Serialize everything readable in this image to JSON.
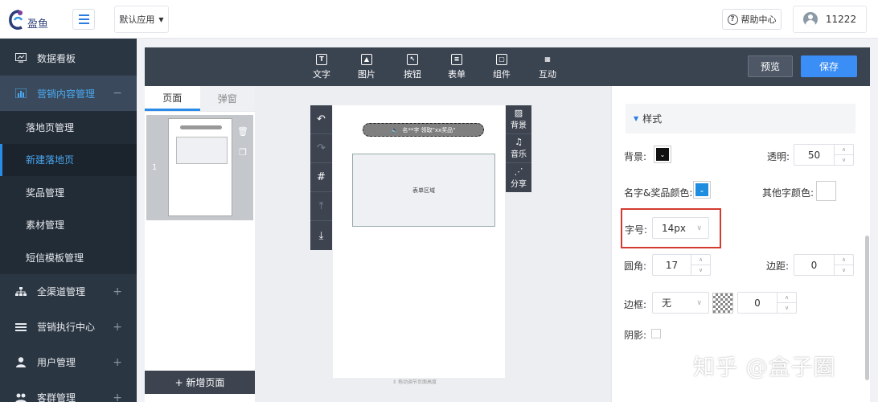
{
  "header": {
    "logo_text": "盈鱼",
    "app_select": "默认应用",
    "help": "帮助中心",
    "user": "11222"
  },
  "sidebar": {
    "items": [
      {
        "label": "数据看板",
        "icon": "dashboard-icon"
      },
      {
        "label": "营销内容管理",
        "icon": "chart-bar-icon",
        "sign": "−"
      },
      {
        "label": "落地页管理"
      },
      {
        "label": "新建落地页"
      },
      {
        "label": "奖品管理"
      },
      {
        "label": "素材管理"
      },
      {
        "label": "短信模板管理"
      },
      {
        "label": "全渠道管理",
        "icon": "sitemap-icon",
        "sign": "+"
      },
      {
        "label": "营销执行中心",
        "icon": "list-icon",
        "sign": "+"
      },
      {
        "label": "用户管理",
        "icon": "user-icon",
        "sign": "+"
      },
      {
        "label": "客群管理",
        "icon": "group-icon",
        "sign": "+"
      }
    ]
  },
  "toolbar": {
    "tools": [
      "文字",
      "图片",
      "按钮",
      "表单",
      "组件",
      "互动"
    ],
    "preview": "预览",
    "save": "保存"
  },
  "pages": {
    "tab_page": "页面",
    "tab_popup": "弹窗",
    "page_number": "1",
    "add_page": "+ 新增页面"
  },
  "canvas": {
    "notice": "名**字 领取\"xx奖品\"",
    "form_area": "表单区域",
    "bottom_hint": "拖动调节页面高度",
    "right_tools": [
      "背景",
      "音乐",
      "分享"
    ]
  },
  "props": {
    "section": "样式",
    "background_label": "背景:",
    "opacity_label": "透明:",
    "opacity_value": "50",
    "name_color_label": "名字&奖品颜色:",
    "other_color_label": "其他字颜色:",
    "font_size_label": "字号:",
    "font_size_value": "14px",
    "radius_label": "圆角:",
    "radius_value": "17",
    "padding_label": "边距:",
    "padding_value": "0",
    "border_label": "边框:",
    "border_value": "无",
    "border_width_value": "0",
    "shadow_label": "阴影:"
  },
  "colors": {
    "accent": "#2a8be8",
    "sidebar_bg": "#2b3643",
    "highlight": "#d43a30"
  },
  "watermark": "知乎 @盒子圈"
}
